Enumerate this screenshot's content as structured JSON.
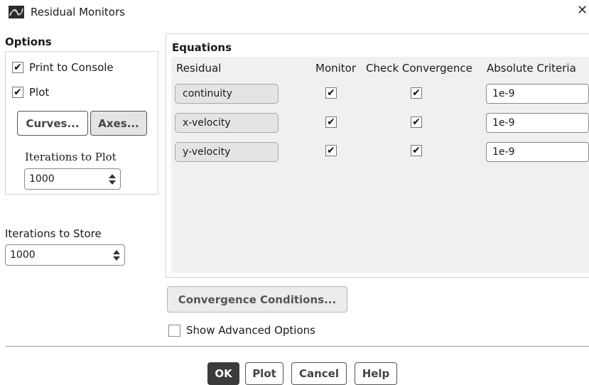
{
  "window": {
    "title": "Residual Monitors",
    "close_glyph": "✕"
  },
  "options": {
    "label": "Options",
    "print_to_console": {
      "label": "Print to Console",
      "checked": true
    },
    "plot": {
      "label": "Plot",
      "checked": true
    },
    "curves_button": "Curves...",
    "axes_button": "Axes...",
    "iterations_to_plot": {
      "label": "Iterations to Plot",
      "value": "1000"
    }
  },
  "iterations_to_store": {
    "label": "Iterations to Store",
    "value": "1000"
  },
  "equations": {
    "label": "Equations",
    "columns": {
      "residual": "Residual",
      "monitor": "Monitor",
      "check_convergence": "Check Convergence",
      "absolute_criteria": "Absolute Criteria"
    },
    "rows": [
      {
        "residual": "continuity",
        "monitor": true,
        "check_convergence": true,
        "absolute_criteria": "1e-9"
      },
      {
        "residual": "x-velocity",
        "monitor": true,
        "check_convergence": true,
        "absolute_criteria": "1e-9"
      },
      {
        "residual": "y-velocity",
        "monitor": true,
        "check_convergence": true,
        "absolute_criteria": "1e-9"
      }
    ]
  },
  "convergence_conditions_button": "Convergence Conditions...",
  "show_advanced_options": {
    "label": "Show Advanced Options",
    "checked": false
  },
  "footer": {
    "ok": "OK",
    "plot": "Plot",
    "cancel": "Cancel",
    "help": "Help"
  },
  "icons": {
    "app": "fluent-residuals-icon",
    "check": "checkmark-icon"
  },
  "colors": {
    "primary_button": "#3b3b3b",
    "panel_bg": "#f0f0f0"
  }
}
